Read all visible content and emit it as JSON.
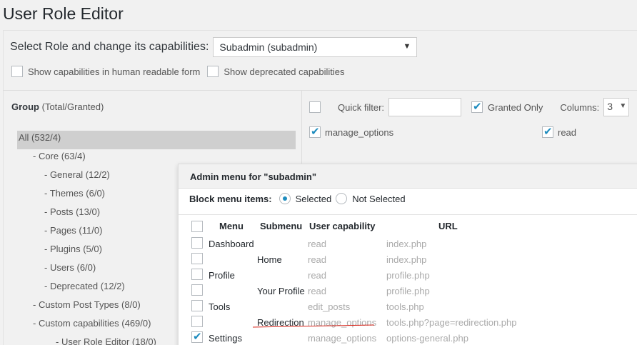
{
  "page": {
    "title": "User Role Editor"
  },
  "role": {
    "label": "Select Role and change its capabilities:",
    "selected": "Subadmin (subadmin)"
  },
  "options": {
    "human_readable": "Show capabilities in human readable form",
    "deprecated": "Show deprecated capabilities"
  },
  "groups": {
    "header_bold": "Group",
    "header_rest": "(Total/Granted)",
    "items": [
      {
        "label": "All (532/4)",
        "indent": 0,
        "selected": true
      },
      {
        "label": "- Core (63/4)",
        "indent": 1
      },
      {
        "label": "- General (12/2)",
        "indent": 2
      },
      {
        "label": "- Themes (6/0)",
        "indent": 2
      },
      {
        "label": "- Posts (13/0)",
        "indent": 2
      },
      {
        "label": "- Pages (11/0)",
        "indent": 2
      },
      {
        "label": "- Plugins (5/0)",
        "indent": 2
      },
      {
        "label": "- Users (6/0)",
        "indent": 2
      },
      {
        "label": "- Deprecated (12/2)",
        "indent": 2
      },
      {
        "label": "- Custom Post Types (8/0)",
        "indent": 1
      },
      {
        "label": "- Custom capabilities (469/0)",
        "indent": 1
      },
      {
        "label": "- User Role Editor (18/0)",
        "indent": 3
      }
    ]
  },
  "filter": {
    "quick_filter_label": "Quick filter:",
    "granted_only_label": "Granted Only",
    "columns_label": "Columns:",
    "columns_value": "3"
  },
  "capabilities": [
    {
      "name": "manage_options",
      "checked": true
    },
    {
      "name": "read",
      "checked": true
    }
  ],
  "dialog": {
    "title": "Admin menu for \"subadmin\"",
    "block_label": "Block menu items:",
    "radio_selected": "Selected",
    "radio_not_selected": "Not Selected",
    "headers": {
      "menu": "Menu",
      "submenu": "Submenu",
      "capability": "User capability",
      "url": "URL"
    },
    "rows": [
      {
        "menu": "Dashboard",
        "submenu": "",
        "capability": "read",
        "url": "index.php",
        "checked": false
      },
      {
        "menu": "",
        "submenu": "Home",
        "capability": "read",
        "url": "index.php",
        "checked": false
      },
      {
        "menu": "Profile",
        "submenu": "",
        "capability": "read",
        "url": "profile.php",
        "checked": false
      },
      {
        "menu": "",
        "submenu": "Your Profile",
        "capability": "read",
        "url": "profile.php",
        "checked": false
      },
      {
        "menu": "Tools",
        "submenu": "",
        "capability": "edit_posts",
        "url": "tools.php",
        "checked": false
      },
      {
        "menu": "",
        "submenu": "Redirection",
        "capability": "manage_options",
        "url": "tools.php?page=redirection.php",
        "checked": false
      },
      {
        "menu": "Settings",
        "submenu": "",
        "capability": "manage_options",
        "url": "options-general.php",
        "checked": true
      }
    ]
  },
  "colors": {
    "accent": "#1e8cbe",
    "highlight_line": "#d9261c",
    "selected_group": "#cfcfcf"
  }
}
